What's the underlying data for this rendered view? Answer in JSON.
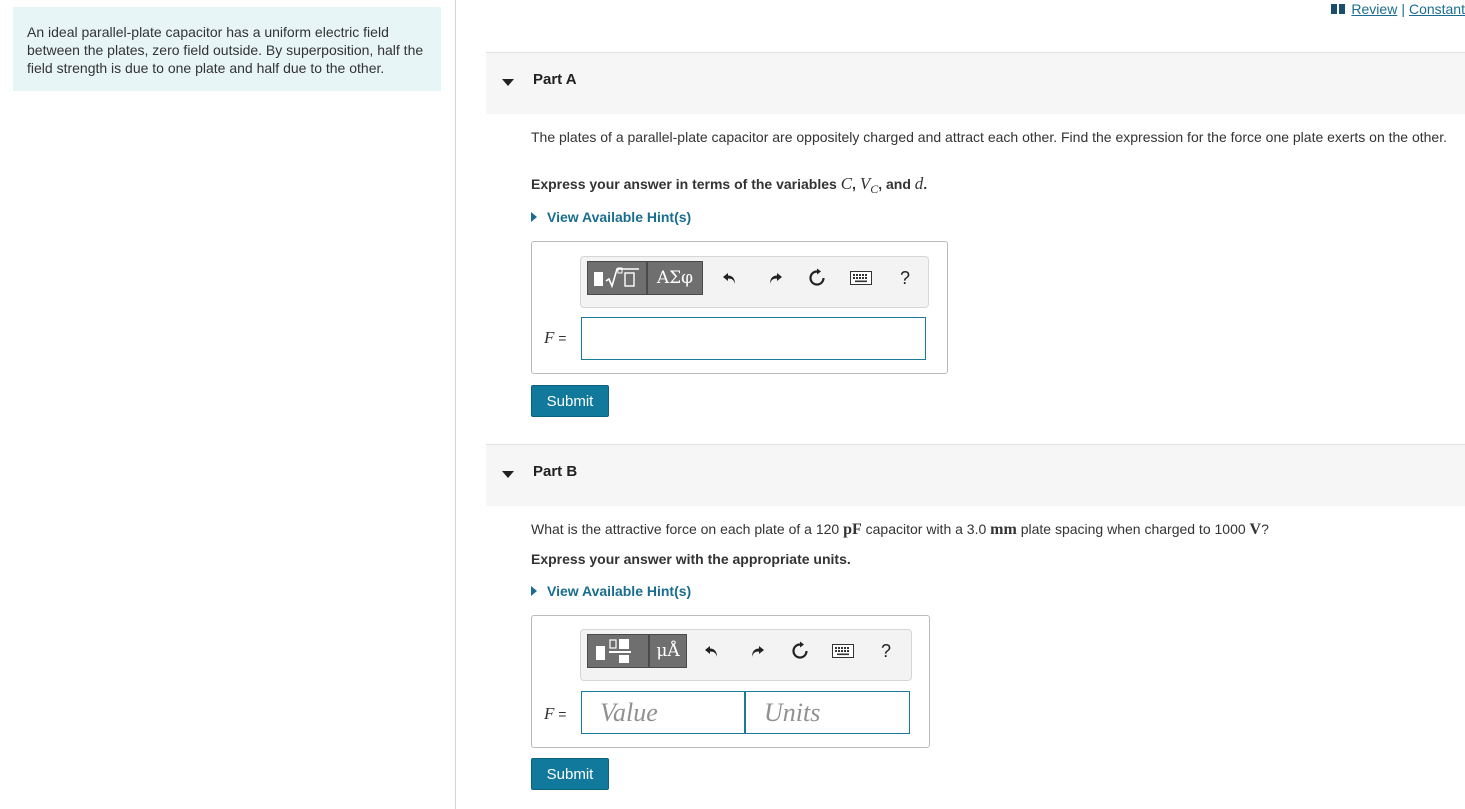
{
  "top_links": {
    "review": "Review",
    "separator": "|",
    "constants": "Constant"
  },
  "intro": {
    "text": "An ideal parallel-plate capacitor has a uniform electric field between the plates, zero field outside. By superposition, half the field strength is due to one plate and half due to the other."
  },
  "part_a": {
    "title": "Part A",
    "question": "The plates of a parallel-plate capacitor are oppositely charged and attract each other. Find the expression for the force one plate exerts on the other.",
    "instruction_prefix": "Express your answer in terms of the variables ",
    "var_c": "C",
    "sep1": ", ",
    "var_v": "V",
    "var_v_sub": "C",
    "sep2": ", and ",
    "var_d": "d",
    "instruction_suffix": ".",
    "hint": "View Available Hint(s)",
    "toolbar": {
      "greek": "ΑΣφ",
      "help": "?"
    },
    "answer_label_var": "F",
    "answer_label_eq": " =",
    "answer_value": "",
    "submit": "Submit"
  },
  "part_b": {
    "title": "Part B",
    "question_1": "What is the attractive force on each plate of a 120 ",
    "unit_1": "pF",
    "question_2": " capacitor with a 3.0 ",
    "unit_2": "mm",
    "question_3": " plate spacing when charged to 1000 ",
    "unit_3": "V",
    "question_4": "?",
    "instruction": "Express your answer with the appropriate units.",
    "hint": "View Available Hint(s)",
    "toolbar": {
      "units": "μÅ",
      "help": "?"
    },
    "answer_label_var": "F",
    "answer_label_eq": " =",
    "value_placeholder": "Value",
    "units_placeholder": "Units",
    "submit": "Submit"
  }
}
